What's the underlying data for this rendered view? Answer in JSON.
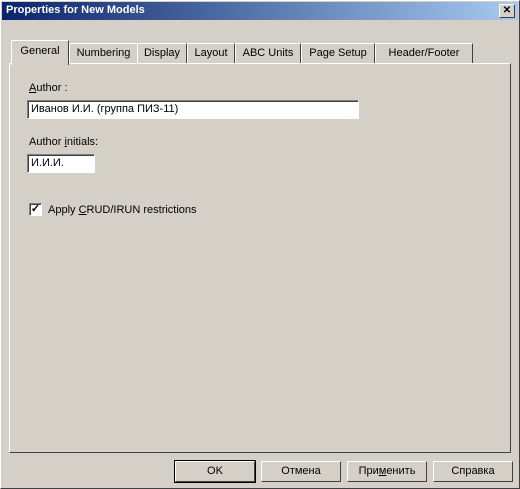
{
  "window": {
    "title": "Properties for New Models",
    "close_glyph": "✕"
  },
  "tabs": [
    {
      "label": "General",
      "active": true
    },
    {
      "label": "Numbering"
    },
    {
      "label": "Display"
    },
    {
      "label": "Layout"
    },
    {
      "label": "ABC Units"
    },
    {
      "label": "Page Setup"
    },
    {
      "label": "Header/Footer"
    }
  ],
  "general": {
    "author_label_pre": "",
    "author_label_key": "A",
    "author_label_post": "uthor :",
    "author_value": "Иванов И.И. (группа ПИЗ-11)",
    "initials_label_pre": "Author ",
    "initials_label_key": "i",
    "initials_label_post": "nitials:",
    "initials_value": "И.И.И.",
    "crud_checked": true,
    "crud_check_glyph": "✓",
    "crud_label_pre": "Apply ",
    "crud_label_key": "C",
    "crud_label_post": "RUD/IRUN restrictions"
  },
  "buttons": {
    "ok": "OK",
    "cancel": "Отмена",
    "apply_pre": "При",
    "apply_key": "м",
    "apply_post": "енить",
    "help": "Справка"
  }
}
